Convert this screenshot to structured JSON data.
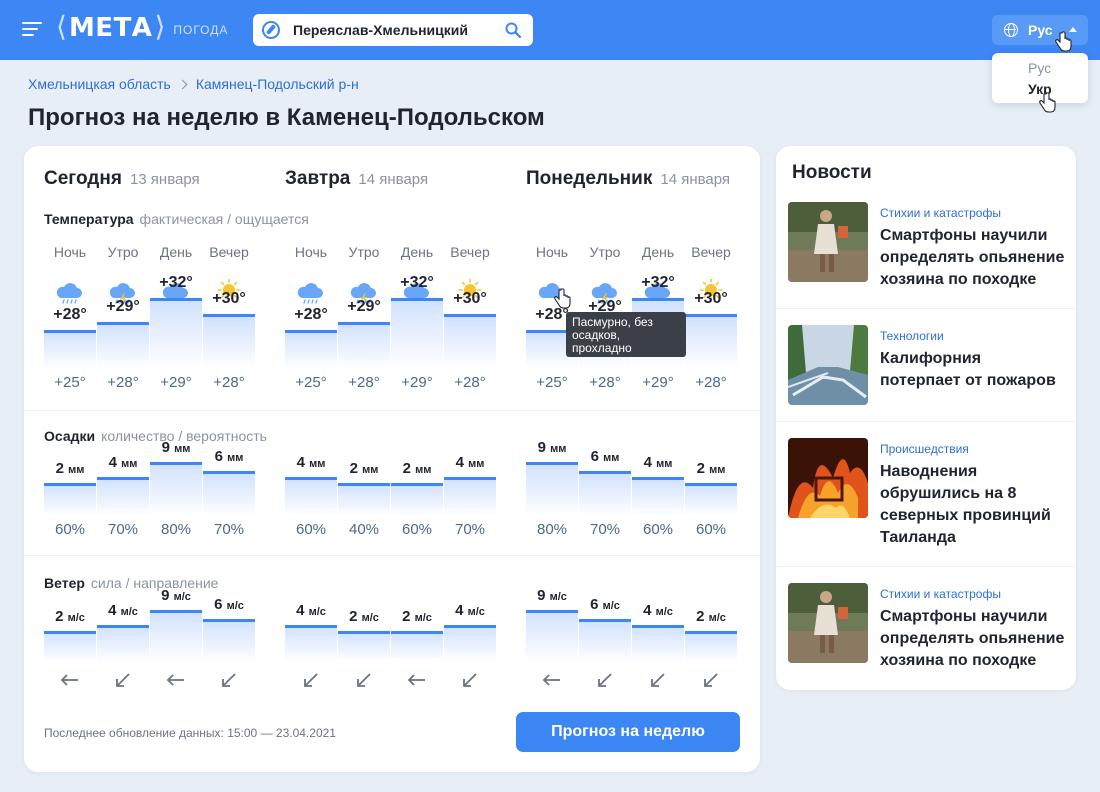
{
  "header": {
    "logo_name": "МЕТА",
    "logo_sub": "ПОГОДА",
    "search_value": "Переяслав-Хмельницкий",
    "lang_current": "Рус",
    "lang_options": [
      "Рус",
      "Укр"
    ]
  },
  "breadcrumb": [
    "Хмельницкая область",
    "Камянец-Подольский р-н"
  ],
  "page_title": "Прогноз на неделю в Каменец-Подольском",
  "days": [
    {
      "name": "Сегодня",
      "date": "13 января",
      "parts": [
        "Ночь",
        "Утро",
        "День",
        "Вечер"
      ],
      "icons": [
        "rain-cloud-icon",
        "storm-cloud-icon",
        "cloud-icon",
        "sun-icon"
      ],
      "temp": [
        "+28°",
        "+29°",
        "+32°",
        "+30°"
      ],
      "feels": [
        "+25°",
        "+28°",
        "+29°",
        "+28°"
      ],
      "precip": [
        "2",
        "4",
        "9",
        "6"
      ],
      "prob": [
        "60%",
        "70%",
        "80%",
        "70%"
      ],
      "wind": [
        "2",
        "4",
        "9",
        "6"
      ],
      "wind_dir": [
        "west",
        "southwest",
        "west",
        "southwest"
      ]
    },
    {
      "name": "Завтра",
      "date": "14 января",
      "parts": [
        "Ночь",
        "Утро",
        "День",
        "Вечер"
      ],
      "icons": [
        "rain-cloud-icon",
        "storm-cloud-icon",
        "cloud-icon",
        "sun-icon"
      ],
      "temp": [
        "+28°",
        "+29°",
        "+32°",
        "+30°"
      ],
      "feels": [
        "+25°",
        "+28°",
        "+29°",
        "+28°"
      ],
      "precip": [
        "4",
        "2",
        "2",
        "4"
      ],
      "prob": [
        "60%",
        "40%",
        "60%",
        "70%"
      ],
      "wind": [
        "4",
        "2",
        "2",
        "4"
      ],
      "wind_dir": [
        "southwest",
        "southwest",
        "west",
        "southwest"
      ]
    },
    {
      "name": "Понедельник",
      "date": "14 января",
      "parts": [
        "Ночь",
        "Утро",
        "День",
        "Вечер"
      ],
      "icons": [
        "cloud-icon",
        "storm-cloud-icon",
        "cloud-icon",
        "sun-icon"
      ],
      "temp": [
        "+28°",
        "+29°",
        "+32°",
        "+30°"
      ],
      "feels": [
        "+25°",
        "+28°",
        "+29°",
        "+28°"
      ],
      "precip": [
        "9",
        "6",
        "4",
        "2"
      ],
      "prob": [
        "80%",
        "70%",
        "60%",
        "60%"
      ],
      "wind": [
        "9",
        "6",
        "4",
        "2"
      ],
      "wind_dir": [
        "west",
        "southwest",
        "southwest",
        "southwest"
      ]
    }
  ],
  "sections": {
    "temp_label": "Температура",
    "temp_sub": "фактическая / ощущается",
    "precip_label": "Осадки",
    "precip_sub": "количество / вероятность",
    "wind_label": "Ветер",
    "wind_sub": "сила / направление",
    "precip_unit": "мм",
    "wind_unit": "м/с"
  },
  "tooltip": "Пасмурно, без осадков, прохладно",
  "updated": "Последнее обновление данных: 15:00 — 23.04.2021",
  "week_button": "Прогноз на неделю",
  "news": {
    "title": "Новости",
    "items": [
      {
        "category": "Стихии и катастрофы",
        "headline": "Смартфоны научили определять опьянение хозяина по походке",
        "image": "flood-photo"
      },
      {
        "category": "Технологии",
        "headline": "Калифорния потерпает от пожаров",
        "image": "river-photo"
      },
      {
        "category": "Происшедствия",
        "headline": "Наводнения обрушились на 8 северных провинций Таиланда",
        "image": "fire-photo"
      },
      {
        "category": "Стихии и катастрофы",
        "headline": "Смартфоны научили определять опьянение хозяина по походке",
        "image": "flood-photo"
      }
    ]
  }
}
